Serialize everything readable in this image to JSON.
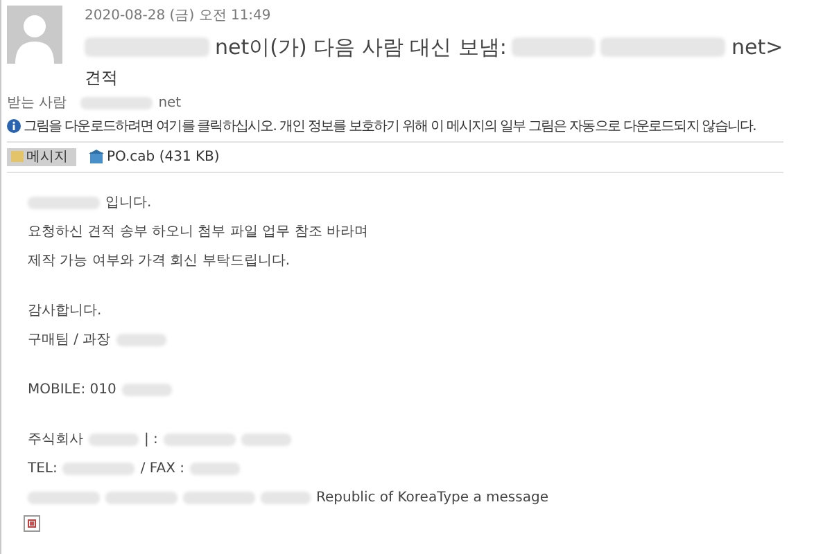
{
  "header": {
    "date": "2020-08-28 (금) 오전 11:49",
    "from": [
      {
        "kind": "wideblur"
      },
      {
        "kind": "text",
        "text": "net이(가) 다음 사람 대신 보냄:"
      },
      {
        "kind": "blur"
      },
      {
        "kind": "wideblur"
      },
      {
        "kind": "text",
        "text": "net>"
      }
    ],
    "subject": "견적",
    "to_label": "받는 사람",
    "to": [
      {
        "kind": "wideblur"
      },
      {
        "kind": "text",
        "text": "net"
      }
    ],
    "info": "그림을 다운로드하려면 여기를 클릭하십시오. 개인 정보를 보호하기 위해 이 메시지의 일부 그림은 자동으로 다운로드되지 않습니다."
  },
  "attachments": [
    {
      "label": "메시지",
      "selected": true
    },
    {
      "label": "PO.cab (431 KB)",
      "selected": false
    }
  ],
  "body": [
    [
      [
        {
          "kind": "wideblur"
        },
        {
          "kind": "text",
          "text": "입니다."
        }
      ],
      [
        {
          "kind": "text",
          "text": "요청하신 견적 송부 하오니 첨부 파일 업무 참조 바라며"
        }
      ],
      [
        {
          "kind": "text",
          "text": "제작 가능 여부와 가격 회신 부탁드립니다."
        }
      ]
    ],
    [
      [
        {
          "kind": "text",
          "text": "감사합니다."
        }
      ],
      [
        {
          "kind": "text",
          "text": "구매팀 / 과장"
        },
        {
          "kind": "blur"
        }
      ]
    ],
    [
      [
        {
          "kind": "text",
          "text": "MOBILE: 010"
        },
        {
          "kind": "blur"
        }
      ]
    ],
    [
      [
        {
          "kind": "text",
          "text": "주식회사"
        },
        {
          "kind": "blur"
        },
        {
          "kind": "text",
          "text": "| :"
        },
        {
          "kind": "wideblur"
        },
        {
          "kind": "blur"
        }
      ],
      [
        {
          "kind": "text",
          "text": "TEL:"
        },
        {
          "kind": "wideblur"
        },
        {
          "kind": "text",
          "text": "/ FAX :"
        },
        {
          "kind": "blur"
        }
      ],
      [
        {
          "kind": "wideblur"
        },
        {
          "kind": "wideblur"
        },
        {
          "kind": "wideblur"
        },
        {
          "kind": "blur"
        },
        {
          "kind": "text",
          "text": "Republic of KoreaType a message"
        }
      ]
    ]
  ]
}
